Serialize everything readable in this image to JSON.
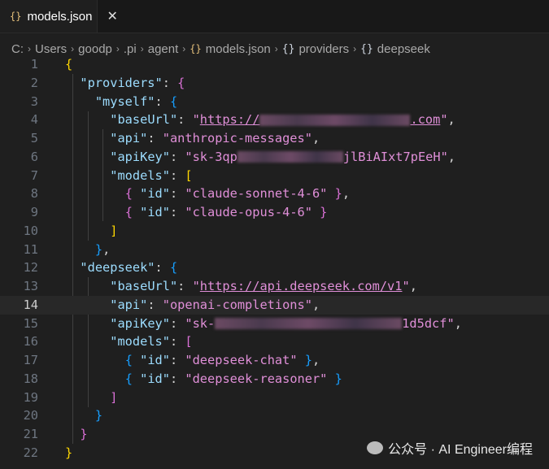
{
  "tab": {
    "icon": "{}",
    "title": "models.json",
    "close": "✕"
  },
  "breadcrumb": [
    "C:",
    "Users",
    "goodp",
    ".pi",
    "agent",
    "models.json",
    "providers",
    "deepseek"
  ],
  "lines": {
    "n": [
      "1",
      "2",
      "3",
      "4",
      "5",
      "6",
      "7",
      "8",
      "9",
      "10",
      "11",
      "12",
      "13",
      "14",
      "15",
      "16",
      "17",
      "18",
      "19",
      "20",
      "21",
      "22"
    ],
    "providers": "\"providers\"",
    "myself": "\"myself\"",
    "baseUrl": "\"baseUrl\"",
    "api": "\"api\"",
    "apiKey": "\"apiKey\"",
    "models": "\"models\"",
    "id": "\"id\"",
    "deepseek": "\"deepseek\"",
    "url1_pre": "https://",
    "url1_post": ".com",
    "api1": "\"anthropic-messages\"",
    "key1_pre": "\"sk-3qp",
    "key1_post": "jlBiAIxt7pEeH\"",
    "m1": "\"claude-sonnet-4-6\"",
    "m2": "\"claude-opus-4-6\"",
    "url2": "https://api.deepseek.com/v1",
    "api2": "\"openai-completions\"",
    "key2_pre": "\"sk-",
    "key2_post": "1d5dcf\"",
    "m3": "\"deepseek-chat\"",
    "m4": "\"deepseek-reasoner\""
  },
  "watermark": "公众号 · AI Engineer编程"
}
